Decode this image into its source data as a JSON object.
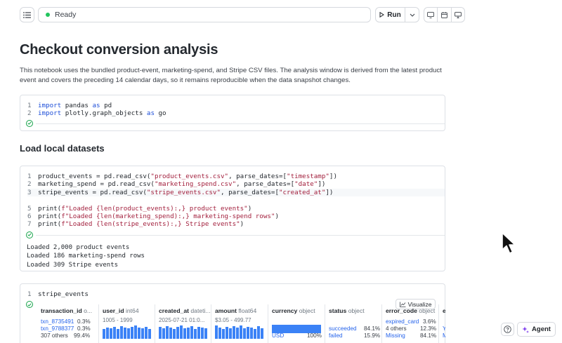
{
  "toolbar": {
    "status": "Ready",
    "run_label": "Run"
  },
  "notebook": {
    "title": "Checkout conversion analysis",
    "intro": "This notebook uses the bundled product-event, marketing-spend, and Stripe CSV files. The analysis window is derived from the latest product event and covers the preceding 14 calendar days, so it remains reproducible when the data snapshot changes.",
    "section_load": "Load local datasets"
  },
  "cells": {
    "imports": {
      "line1": {
        "n": "1",
        "kw1": "import",
        "mid": " pandas ",
        "kw2": "as",
        "tail": " pd"
      },
      "line2": {
        "n": "2",
        "kw1": "import",
        "mid": " plotly.graph_objects ",
        "kw2": "as",
        "tail": " go"
      }
    },
    "load": {
      "l1": {
        "n": "1",
        "a": "product_events = pd.read_csv(",
        "s1": "\"product_events.csv\"",
        "b": ", parse_dates=[",
        "s2": "\"timestamp\"",
        "c": "])"
      },
      "l2": {
        "n": "2",
        "a": "marketing_spend = pd.read_csv(",
        "s1": "\"marketing_spend.csv\"",
        "b": ", parse_dates=[",
        "s2": "\"date\"",
        "c": "])"
      },
      "l3": {
        "n": "3",
        "a": "stripe_events = pd.read_csv(",
        "s1": "\"stripe_events.csv\"",
        "b": ", parse_dates=[",
        "s2": "\"created_at\"",
        "c": "])"
      },
      "l5": {
        "n": "5",
        "a": "print(",
        "s": "f\"Loaded {len(product_events):,} product events\"",
        "c": ")"
      },
      "l6": {
        "n": "6",
        "a": "print(",
        "s": "f\"Loaded {len(marketing_spend):,} marketing-spend rows\"",
        "c": ")"
      },
      "l7": {
        "n": "7",
        "a": "print(",
        "s": "f\"Loaded {len(stripe_events):,} Stripe events\"",
        "c": ")"
      },
      "output": [
        "Loaded 2,000 product events",
        "Loaded 186 marketing-spend rows",
        "Loaded 309 Stripe events"
      ]
    },
    "preview": {
      "line1": {
        "n": "1",
        "code": "stripe_events"
      },
      "visualize_label": "Visualize",
      "columns": {
        "transaction_id": {
          "name": "transaction_id",
          "type": "o...",
          "rows": [
            {
              "label": "txn_8735491",
              "pct": "0.3%"
            },
            {
              "label": "txn_9788377",
              "pct": "0.3%"
            },
            {
              "label": "307 others",
              "pct": "99.4%"
            }
          ]
        },
        "user_id": {
          "name": "user_id",
          "type": "int64",
          "range": "1005 - 1999"
        },
        "created_at": {
          "name": "created_at",
          "type": "dateti...",
          "range": "2025-07-21 01:0..."
        },
        "amount": {
          "name": "amount",
          "type": "float64",
          "range": "$3.05 - 499.77"
        },
        "currency": {
          "name": "currency",
          "type": "object",
          "rows": [
            {
              "label": "USD",
              "pct": "100%"
            }
          ]
        },
        "status": {
          "name": "status",
          "type": "object",
          "rows": [
            {
              "label": "succeeded",
              "pct": "84.1%"
            },
            {
              "label": "failed",
              "pct": "15.9%"
            }
          ]
        },
        "error_code": {
          "name": "error_code",
          "type": "object",
          "rows": [
            {
              "label": "expired_card",
              "pct": "3.6%"
            },
            {
              "label": "4 others",
              "pct": "12.3%"
            },
            {
              "label": "Missing",
              "pct": "84.1%"
            }
          ]
        },
        "next_col": {
          "name": "e",
          "rows": [
            {
              "label": "Y"
            },
            {
              "label": "M"
            }
          ]
        }
      },
      "histograms": {
        "user_id": [
          14,
          16,
          15,
          17,
          14,
          18,
          16,
          15,
          17,
          19,
          16,
          15,
          17,
          14
        ],
        "created_at": [
          17,
          15,
          18,
          16,
          14,
          17,
          19,
          15,
          16,
          18,
          14,
          17,
          16,
          15
        ],
        "amount": [
          19,
          16,
          14,
          17,
          15,
          18,
          16,
          19,
          15,
          17,
          16,
          14,
          18,
          15
        ]
      }
    }
  },
  "floating": {
    "agent_label": "Agent"
  },
  "colors": {
    "accent": "#3b82f6",
    "success": "#22c55e",
    "keyword": "#1d4ed8",
    "string": "#a3213e"
  }
}
